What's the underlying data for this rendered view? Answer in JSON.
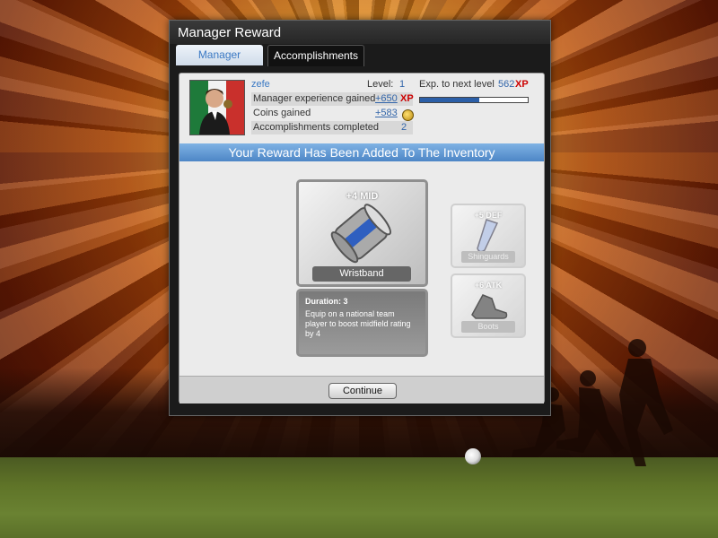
{
  "window": {
    "title": "Manager Reward"
  },
  "tabs": [
    {
      "label": "Manager",
      "active": true
    },
    {
      "label": "Accomplishments",
      "active": false
    }
  ],
  "manager": {
    "name": "zefe",
    "level_label": "Level:",
    "level_value": "1",
    "exp_next_label": "Exp. to next level",
    "exp_next_value": "562",
    "xp_unit": "XP",
    "exp_progress_fraction": 0.55,
    "exp_gained_label": "Manager experience gained",
    "exp_gained_value": "+650",
    "coins_label": "Coins gained",
    "coins_value": "+583",
    "accomplishments_label": "Accomplishments completed",
    "accomplishments_value": "2"
  },
  "banner": "Your Reward Has Been Added To The Inventory",
  "reward": {
    "stat": "+4 MID",
    "item_name": "Wristband",
    "duration_label": "Duration:",
    "duration_value": "3",
    "description": "Equip on a national team player to boost midfield rating by 4"
  },
  "other_items": [
    {
      "stat": "+5 DEF",
      "name": "Shinguards"
    },
    {
      "stat": "+6 ATK",
      "name": "Boots"
    }
  ],
  "continue_label": "Continue",
  "colors": {
    "accent_blue": "#3b79c4",
    "banner_blue": "#5f97d2",
    "xp_red": "#cc0000",
    "progress_fill": "#2b5fa8"
  }
}
